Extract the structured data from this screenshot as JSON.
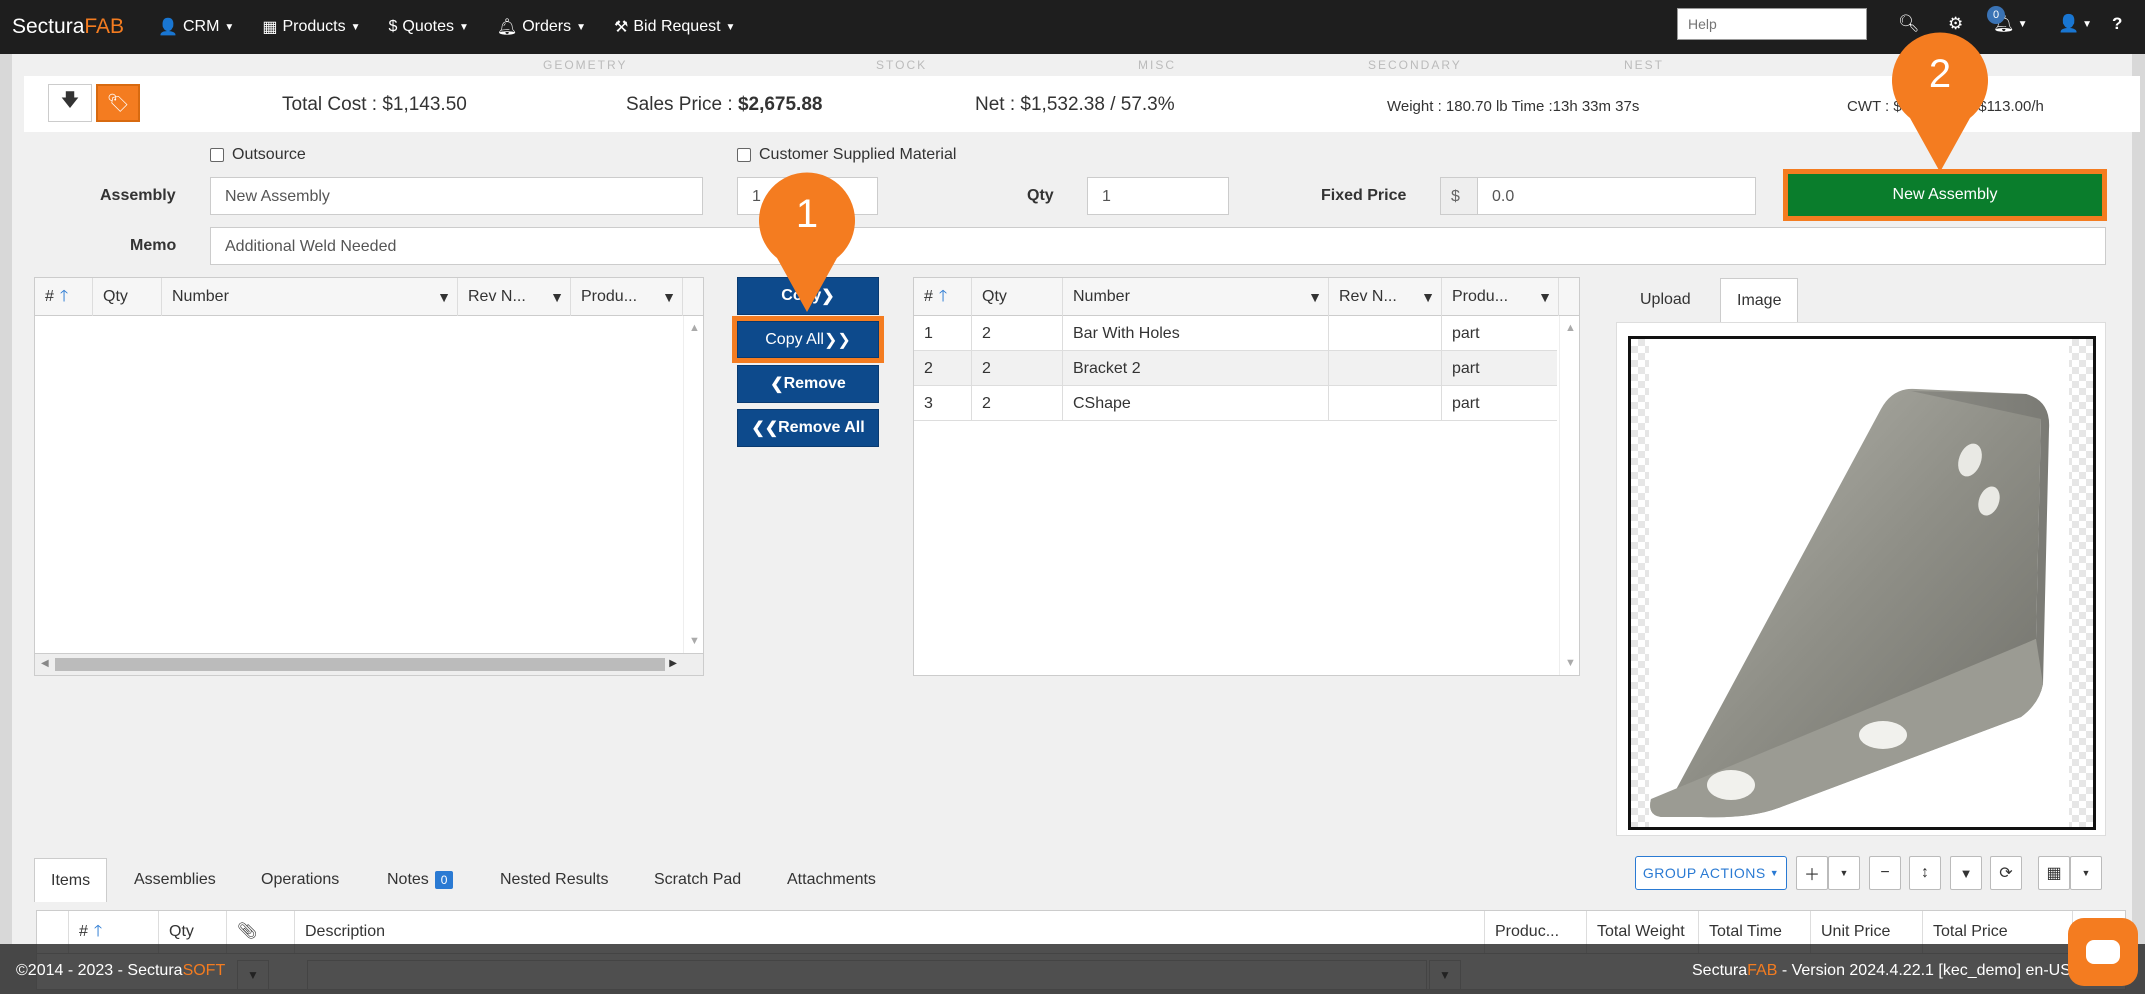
{
  "nav": {
    "brand_a": "Sectura",
    "brand_b": "FAB",
    "items": [
      {
        "icon": "user-icon",
        "label": "CRM"
      },
      {
        "icon": "grid-icon",
        "label": "Products"
      },
      {
        "icon": "dollar-icon",
        "label": "Quotes"
      },
      {
        "icon": "bell-icon",
        "label": "Orders"
      },
      {
        "icon": "gavel-icon",
        "label": "Bid Request"
      }
    ],
    "help_placeholder": "Help",
    "notification_count": "0"
  },
  "steps": [
    "GEOMETRY",
    "STOCK",
    "MISC",
    "SECONDARY",
    "NEST"
  ],
  "summary": {
    "total_cost": "Total Cost : $1,143.50",
    "sales_price_label": "Sales Price : ",
    "sales_price_value": "$2,675.88",
    "net": "Net : $1,532.38 / 57.3%",
    "weight_time": "Weight : 180.70 lb Time :13h 33m 37s",
    "cwt_a": "CWT : $17",
    "cwt_b": "T :$113.00/h"
  },
  "form": {
    "outsource_label": "Outsource",
    "customer_supplied_label": "Customer Supplied Material",
    "assembly_label": "Assembly",
    "assembly_value": "New Assembly",
    "rev_value": "1",
    "qty_label": "Qty",
    "qty_value": "1",
    "fixed_price_label": "Fixed Price",
    "currency_symbol": "$",
    "fixed_price_value": "0.0",
    "new_assembly_button": "New Assembly",
    "memo_label": "Memo",
    "memo_value": "Additional Weld Needed"
  },
  "left_grid": {
    "headers": [
      "#",
      "Qty",
      "Number",
      "Rev N...",
      "Produ..."
    ]
  },
  "transfer_buttons": {
    "copy": "Copy",
    "copy_all": "Copy All",
    "remove": "Remove",
    "remove_all": "Remove All"
  },
  "right_grid": {
    "headers": [
      "#",
      "Qty",
      "Number",
      "Rev N...",
      "Produ..."
    ],
    "rows": [
      {
        "num": "1",
        "qty": "2",
        "number": "Bar With Holes",
        "rev": "",
        "product": "part"
      },
      {
        "num": "2",
        "qty": "2",
        "number": "Bracket 2",
        "rev": "",
        "product": "part"
      },
      {
        "num": "3",
        "qty": "2",
        "number": "CShape",
        "rev": "",
        "product": "part"
      }
    ]
  },
  "image_tabs": {
    "upload": "Upload",
    "image": "Image"
  },
  "bottom_tabs": {
    "items": "Items",
    "assemblies": "Assemblies",
    "operations": "Operations",
    "notes": "Notes",
    "notes_count": "0",
    "nested_results": "Nested Results",
    "scratch_pad": "Scratch Pad",
    "attachments": "Attachments"
  },
  "group_actions": "GROUP ACTIONS",
  "bottom_grid": {
    "headers": [
      "#",
      "Qty",
      "",
      "Description",
      "Produc...",
      "Total Weight",
      "Total Time",
      "Unit Price",
      "Total Price"
    ]
  },
  "footer": {
    "left_a": "©2014 - 2023 - Sectura",
    "left_b": "SOFT",
    "right_a": "Sectura",
    "right_b": "FAB",
    "right_c": " - Version 2024.4.22.1 [kec_demo] en-US"
  },
  "callouts": {
    "one": "1",
    "two": "2"
  },
  "colors": {
    "accent": "#f47c20",
    "primary_blue": "#0d4a8c",
    "green": "#0a7d2c",
    "navbar": "#1e1e1e"
  }
}
